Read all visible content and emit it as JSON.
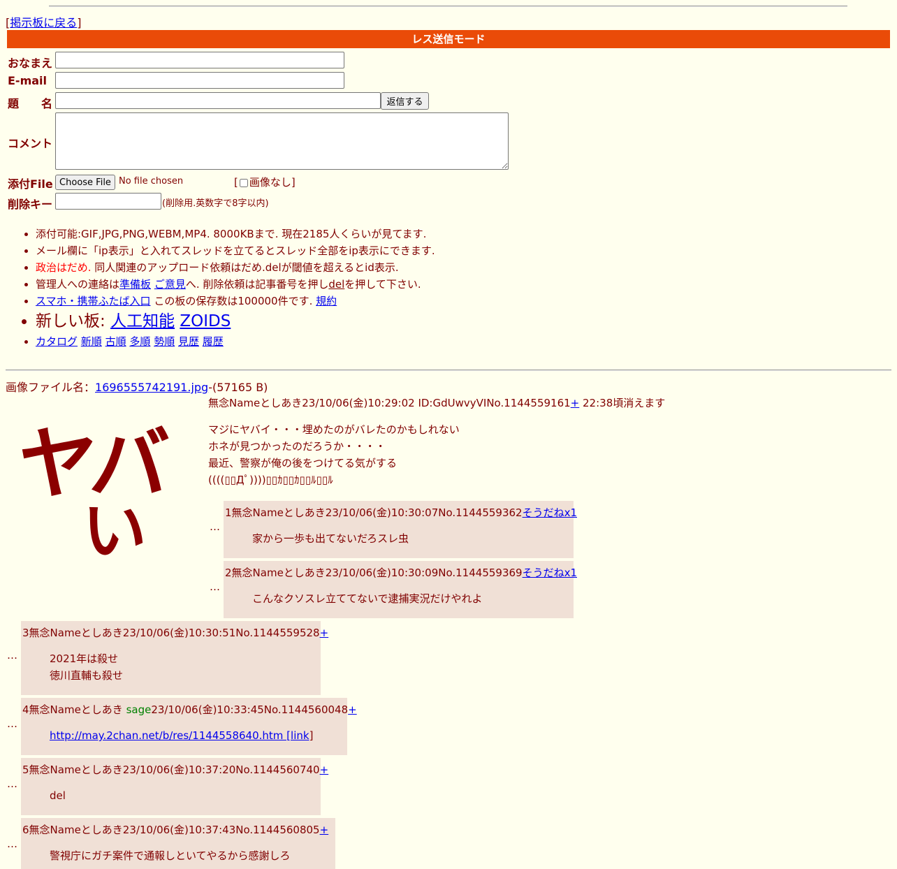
{
  "nav": {
    "back_bracket_open": "[",
    "back_link": "掲示板に戻る",
    "back_bracket_close": "]"
  },
  "mode_bar": "レス送信モード",
  "form": {
    "name_label": "おなまえ",
    "email_label": "E-mail",
    "subject_label": "題　　名",
    "submit_label": "返信する",
    "comment_label": "コメント",
    "file_label": "添付File",
    "file_button": "Choose File",
    "file_status": "No file chosen",
    "noimage_open": "[",
    "noimage_label": "画像なし]",
    "delkey_label": "削除キー",
    "delkey_note": "(削除用.英数字で8字以内)"
  },
  "info": {
    "line1": "添付可能:GIF,JPG,PNG,WEBM,MP4. 8000KBまで. 現在2185人くらいが見てます.",
    "line2": "メール欄に「ip表示」と入れてスレッドを立てるとスレッド全部をip表示にできます.",
    "line3_red": "政治はだめ.",
    "line3_rest": " 同人関連のアップロード依頼はだめ.delが閾値を超えるとid表示.",
    "line4_a": "管理人への連絡は",
    "line4_link1": "準備板",
    "line4_link2": "ご意見",
    "line4_b": "へ. 削除依頼は記事番号を押し",
    "line4_del": "del",
    "line4_c": "を押して下さい.",
    "line5_link": "スマホ・携帯ふたば入口",
    "line5_text": " この板の保存数は100000件です.",
    "line5_link2": "規約",
    "new_boards_label": "新しい板: ",
    "new_board1": "人工知能",
    "new_board2": "ZOIDS",
    "sort_links": [
      "カタログ",
      "新順",
      "古順",
      "多順",
      "勢順",
      "見歴",
      "履歴"
    ]
  },
  "thread": {
    "file_label": "画像ファイル名：",
    "file_name": "1696555742191.jpg",
    "file_size": "-(57165 B)",
    "image_text_line1": "ヤバ",
    "image_text_line2": "い",
    "header_text": "無念Nameとしあき23/10/06(金)10:29:02 ID:GdUwvyVINo.1144559161",
    "header_plus": "+",
    "header_expire": " 22:38頃消えます",
    "body": [
      "マジにヤバイ・・・埋めたのがバレたのかもしれない",
      "ホネが見つかったのだろうか・・・・",
      "最近、警察が俺の後をつけてる気がする",
      "((((▯▯Дﾟ))))▯▯ｶ▯▯ｶ▯▯ﾙ▯▯ﾙ"
    ]
  },
  "replies": [
    {
      "header": "1無念Nameとしあき23/10/06(金)10:30:07No.1144559362",
      "link": "そうだねx1",
      "body": [
        "家から一歩も出てないだろスレ虫"
      ]
    },
    {
      "header": "2無念Nameとしあき23/10/06(金)10:30:09No.1144559369",
      "link": "そうだねx1",
      "body": [
        "こんなクソスレ立ててないで逮捕実況だけやれよ"
      ]
    },
    {
      "header": "3無念Nameとしあき23/10/06(金)10:30:51No.1144559528",
      "link": "+",
      "body": [
        "2021年は殺せ",
        "徳川直輔も殺せ"
      ]
    },
    {
      "header_a": "4無念Nameとしあき ",
      "sage": "sage",
      "header_b": "23/10/06(金)10:33:45No.1144560048",
      "link": "+",
      "body_link": "http://may.2chan.net/b/res/1144558640.htm [link",
      "body_after": "]"
    },
    {
      "header": "5無念Nameとしあき23/10/06(金)10:37:20No.1144560740",
      "link": "+",
      "body": [
        "del"
      ]
    },
    {
      "header": "6無念Nameとしあき23/10/06(金)10:37:43No.1144560805",
      "link": "+",
      "body": [
        "警視庁にガチ案件で通報しといてやるから感謝しろ"
      ]
    }
  ],
  "dots": "…",
  "colors": {
    "background": "#ffffee",
    "text": "#800000",
    "mode_bar": "#ea4b08",
    "reply_bg": "#f0e0d6",
    "link": "#0000ee",
    "sage": "#008000"
  }
}
